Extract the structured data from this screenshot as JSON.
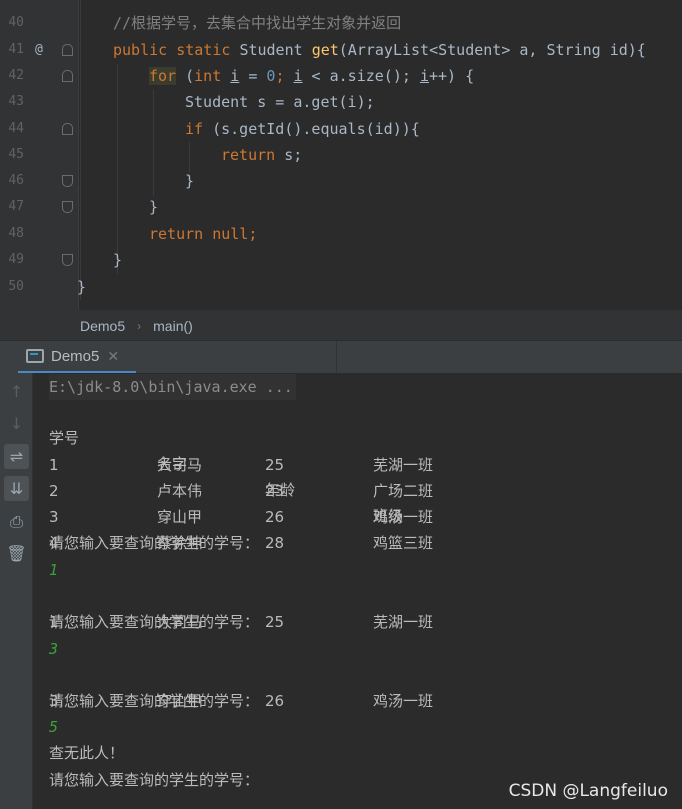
{
  "editor": {
    "lines": [
      {
        "num": "40",
        "comment": "//根据学号，去集合中找出学生对象并返回"
      },
      {
        "num": "41",
        "annotation": "@",
        "kw1": "public static ",
        "type": "Student ",
        "fn": "get",
        "rest": "(ArrayList<Student> a, String id){"
      },
      {
        "num": "42",
        "kw_for": "for",
        "p1": " (",
        "kw_int": "int",
        "p2": " ",
        "var1": "i",
        "p3": " = ",
        "zero": "0",
        "p4": "; ",
        "var2": "i",
        "p5": " < a.size(); ",
        "var3": "i",
        "p6": "++) {"
      },
      {
        "num": "43",
        "text": "Student s = a.get(i);"
      },
      {
        "num": "44",
        "kw_if": "if",
        "text": " (s.getId().equals(id)){"
      },
      {
        "num": "45",
        "kw_return": "return",
        "text": " s;"
      },
      {
        "num": "46",
        "text": "}"
      },
      {
        "num": "47",
        "text": "}"
      },
      {
        "num": "48",
        "kw_return": "return null",
        "text": ";"
      },
      {
        "num": "49",
        "text": "}"
      },
      {
        "num": "50",
        "text": "}"
      }
    ]
  },
  "breadcrumb": {
    "class_name": "Demo5",
    "method_name": "main()"
  },
  "run_tab": {
    "label": "Demo5",
    "close": "✕"
  },
  "console": {
    "command": "E:\\jdk-8.0\\bin\\java.exe ...",
    "header": [
      "学号",
      "名字",
      "年龄",
      "班级"
    ],
    "rows": [
      [
        "1",
        "大司马",
        "25",
        "芜湖一班"
      ],
      [
        "2",
        "卢本伟",
        "23",
        "广场二班"
      ],
      [
        "3",
        "穿山甲",
        "26",
        "鸡汤一班"
      ],
      [
        "4",
        "蔡徐坤",
        "28",
        "鸡篮三班"
      ]
    ],
    "prompt": "请您输入要查询的学生的学号：",
    "input1": "1",
    "result1": [
      "1",
      "大司马",
      "25",
      "芜湖一班"
    ],
    "input2": "3",
    "result2": [
      "3",
      "穿山甲",
      "26",
      "鸡汤一班"
    ],
    "input3": "5",
    "not_found": "查无此人！"
  },
  "watermark": "CSDN @Langfeiluo"
}
